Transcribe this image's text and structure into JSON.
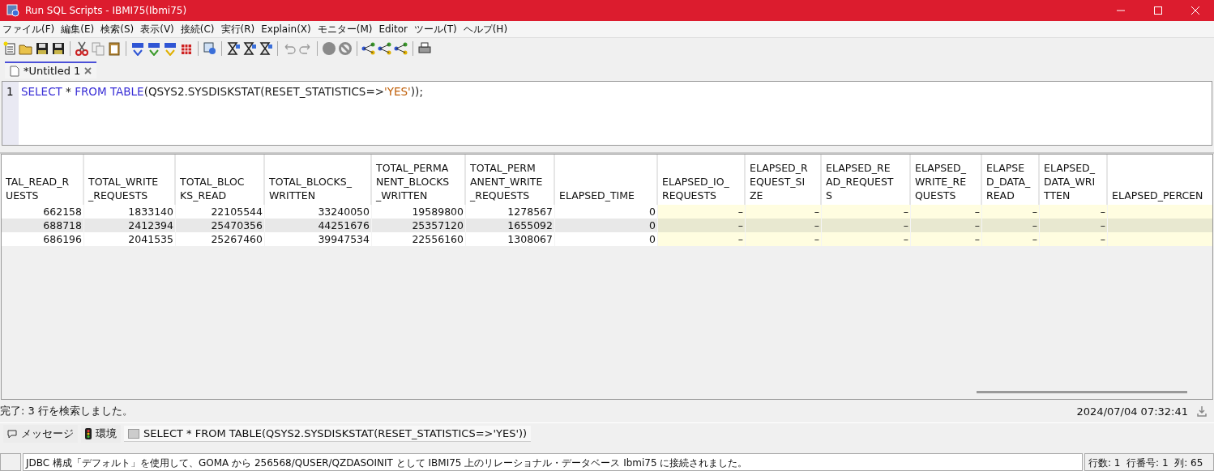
{
  "window": {
    "title": "Run SQL Scripts - IBMI75(Ibmi75)"
  },
  "menu": [
    "ファイル(F)",
    "編集(E)",
    "検索(S)",
    "表示(V)",
    "接続(C)",
    "実行(R)",
    "Explain(X)",
    "モニター(M)",
    "Editor",
    "ツール(T)",
    "ヘルプ(H)"
  ],
  "editor_tabs": [
    {
      "label": "*Untitled 1",
      "selected": true
    }
  ],
  "editor": {
    "line_number": "1",
    "tokens": [
      {
        "text": "SELECT",
        "kind": "keyword"
      },
      {
        "text": " * ",
        "kind": "plain"
      },
      {
        "text": "FROM TABLE",
        "kind": "keyword"
      },
      {
        "text": "(QSYS2.SYSDISKSTAT(RESET_STATISTICS=>",
        "kind": "plain"
      },
      {
        "text": "'YES'",
        "kind": "string"
      },
      {
        "text": "));",
        "kind": "plain"
      }
    ]
  },
  "table": {
    "columns": [
      {
        "lines": [
          "TAL_READ_R",
          "UESTS"
        ]
      },
      {
        "lines": [
          "TOTAL_WRITE",
          "_REQUESTS"
        ]
      },
      {
        "lines": [
          "TOTAL_BLOC",
          "KS_READ"
        ]
      },
      {
        "lines": [
          "TOTAL_BLOCKS_",
          "WRITTEN"
        ]
      },
      {
        "lines": [
          "TOTAL_PERMA",
          "NENT_BLOCKS",
          "_WRITTEN"
        ]
      },
      {
        "lines": [
          "TOTAL_PERM",
          "ANENT_WRITE",
          "_REQUESTS"
        ]
      },
      {
        "lines": [
          "ELAPSED_TIME"
        ]
      },
      {
        "lines": [
          "ELAPSED_IO_",
          "REQUESTS"
        ]
      },
      {
        "lines": [
          "ELAPSED_R",
          "EQUEST_SI",
          "ZE"
        ]
      },
      {
        "lines": [
          "ELAPSED_RE",
          "AD_REQUEST",
          "S"
        ]
      },
      {
        "lines": [
          "ELAPSED_",
          "WRITE_RE",
          "QUESTS"
        ]
      },
      {
        "lines": [
          "ELAPSE",
          "D_DATA_",
          "READ"
        ]
      },
      {
        "lines": [
          "ELAPSED_",
          "DATA_WRI",
          "TTEN"
        ]
      },
      {
        "lines": [
          "ELAPSED_PERCEN"
        ]
      }
    ],
    "rows": [
      [
        {
          "text": "662158",
          "null": false
        },
        {
          "text": "1833140",
          "null": false
        },
        {
          "text": "22105544",
          "null": false
        },
        {
          "text": "33240050",
          "null": false
        },
        {
          "text": "19589800",
          "null": false
        },
        {
          "text": "1278567",
          "null": false
        },
        {
          "text": "0",
          "null": false
        },
        {
          "text": "–",
          "null": true
        },
        {
          "text": "–",
          "null": true
        },
        {
          "text": "–",
          "null": true
        },
        {
          "text": "–",
          "null": true
        },
        {
          "text": "–",
          "null": true
        },
        {
          "text": "–",
          "null": true
        },
        {
          "null": true
        }
      ],
      [
        {
          "text": "688718",
          "null": false
        },
        {
          "text": "2412394",
          "null": false
        },
        {
          "text": "25470356",
          "null": false
        },
        {
          "text": "44251676",
          "null": false
        },
        {
          "text": "25357120",
          "null": false
        },
        {
          "text": "1655092",
          "null": false
        },
        {
          "text": "0",
          "null": false
        },
        {
          "text": "–",
          "null": true
        },
        {
          "text": "–",
          "null": true
        },
        {
          "text": "–",
          "null": true
        },
        {
          "text": "–",
          "null": true
        },
        {
          "text": "–",
          "null": true
        },
        {
          "text": "–",
          "null": true
        },
        {
          "null": true
        }
      ],
      [
        {
          "text": "686196",
          "null": false
        },
        {
          "text": "2041535",
          "null": false
        },
        {
          "text": "25267460",
          "null": false
        },
        {
          "text": "39947534",
          "null": false
        },
        {
          "text": "22556160",
          "null": false
        },
        {
          "text": "1308067",
          "null": false
        },
        {
          "text": "0",
          "null": false
        },
        {
          "text": "–",
          "null": true
        },
        {
          "text": "–",
          "null": true
        },
        {
          "text": "–",
          "null": true
        },
        {
          "text": "–",
          "null": true
        },
        {
          "text": "–",
          "null": true
        },
        {
          "text": "–",
          "null": true
        },
        {
          "null": true
        }
      ]
    ]
  },
  "result_status": {
    "message": "完了: 3 行を検索しました。",
    "timestamp": "2024/07/04 07:32:41"
  },
  "bottom_tabs": [
    {
      "label": "メッセージ",
      "kind": "messages",
      "selected": false
    },
    {
      "label": "環境",
      "kind": "environment",
      "selected": false
    },
    {
      "label": "SELECT * FROM TABLE(QSYS2.SYSDISKSTAT(RESET_STATISTICS=>'YES'))",
      "kind": "statement",
      "selected": true
    }
  ],
  "status_bar": {
    "message": "JDBC 構成「デフォルト」を使用して、GOMA から 256568/QUSER/QZDASOINIT として IBMI75 上のリレーショナル・データベース Ibmi75 に接続されました。",
    "position": "行数: 1  行番号: 1  列: 65"
  }
}
